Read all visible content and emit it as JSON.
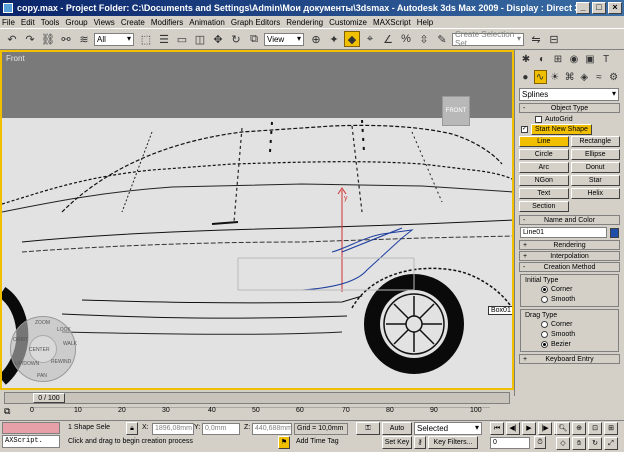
{
  "title": "copy.max   - Project Folder: C:\\Documents and Settings\\Admin\\Мои документы\\3dsmax    - Autodesk 3ds Max  2009        - Display : Direct 3D",
  "menu": [
    "File",
    "Edit",
    "Tools",
    "Group",
    "Views",
    "Create",
    "Modifiers",
    "Animation",
    "Graph Editors",
    "Rendering",
    "Customize",
    "MAXScript",
    "Help"
  ],
  "toolbar": {
    "selection_filter": "All",
    "coord_system": "View",
    "named_selection_placeholder": "Create Selection Set"
  },
  "viewport": {
    "label": "Front",
    "viewcube_label": "FRONT",
    "object_label": "Box01",
    "steering_wheel": [
      "ZOOM",
      "ORBIT",
      "CENTER",
      "WALK",
      "REWIND",
      "PAN",
      "UP/DOWN",
      "LOOK"
    ]
  },
  "command_panel": {
    "category": "Splines",
    "object_type_header": "Object Type",
    "autogrid_label": "AutoGrid",
    "start_new_shape_label": "Start New Shape",
    "buttons": [
      "Line",
      "Rectangle",
      "Circle",
      "Ellipse",
      "Arc",
      "Donut",
      "NGon",
      "Star",
      "Text",
      "Helix",
      "Section"
    ],
    "name_and_color_header": "Name and Color",
    "object_name": "Line01",
    "object_color": "#1f4fa8",
    "rendering_header": "Rendering",
    "interpolation_header": "Interpolation",
    "creation_method_header": "Creation Method",
    "initial_type_label": "Initial Type",
    "initial_type_options": [
      "Corner",
      "Smooth"
    ],
    "drag_type_label": "Drag Type",
    "drag_type_options": [
      "Corner",
      "Smooth",
      "Bezier"
    ],
    "keyboard_entry_header": "Keyboard Entry"
  },
  "timeline": {
    "frame_display": "0 / 100",
    "ticks": [
      "0",
      "10",
      "20",
      "30",
      "40",
      "50",
      "60",
      "70",
      "80",
      "90",
      "100"
    ]
  },
  "status": {
    "maxscript_label": "AXScript.",
    "selection_info": "1 Shape Sele",
    "x_label": "X:",
    "x_value": "1896,08mm",
    "y_label": "Y:",
    "y_value": "0,0mm",
    "z_label": "Z:",
    "z_value": "440,688mm",
    "grid_value": "Grid = 10,0mm",
    "prompt": "Click and drag to begin creation process",
    "add_time_tag": "Add Time Tag",
    "auto_key": "Auto Key",
    "set_key": "Set Key",
    "key_mode": "Selected",
    "key_filters": "Key Filters...",
    "current_frame": "0"
  },
  "colors": {
    "accent": "#f0c000",
    "panel": "#d4d0c8",
    "titlebar": "#0a246a"
  }
}
